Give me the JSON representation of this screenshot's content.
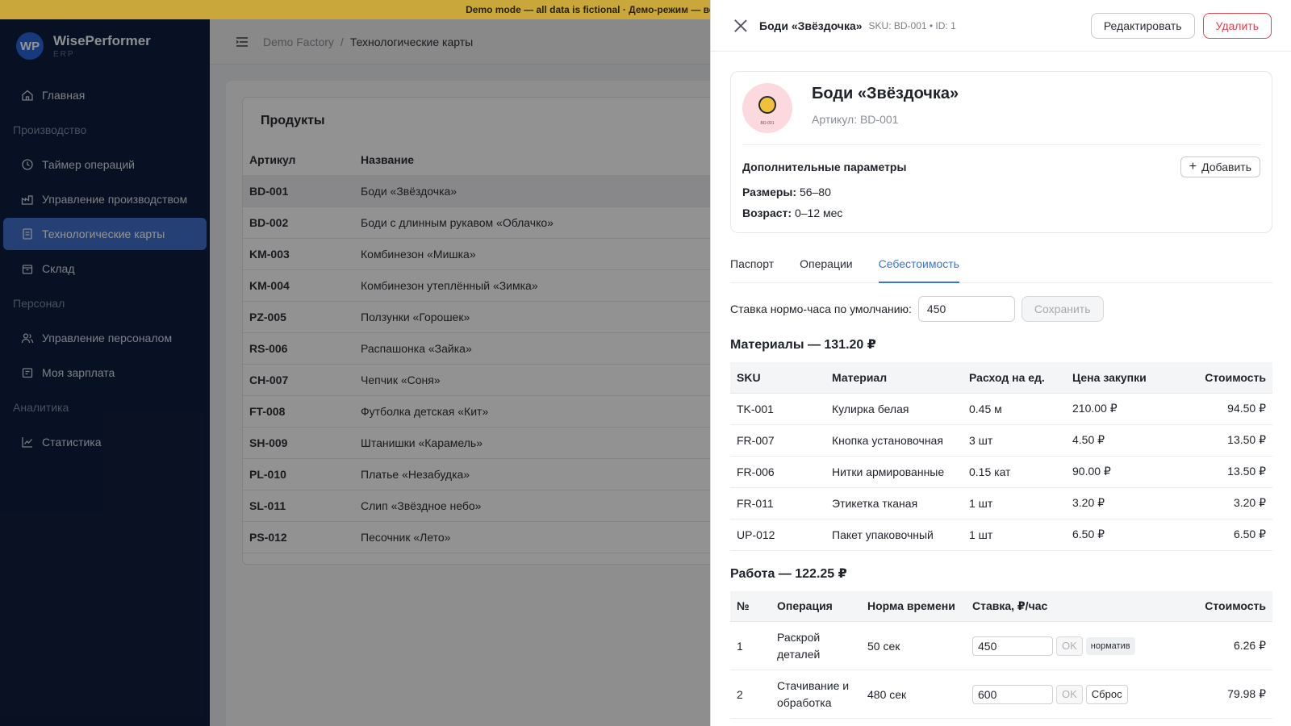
{
  "banner": {
    "text": "Demo mode — all data is fictional · Демо-режим — все данные вымышлены"
  },
  "brand": {
    "logo": "WP",
    "name": "WisePerformer",
    "sub": "ERP"
  },
  "sidebar": {
    "home": "Главная",
    "section_production": "Производство",
    "timer": "Таймер операций",
    "production_mgmt": "Управление производством",
    "tech_cards": "Технологические карты",
    "warehouse": "Склад",
    "section_staff": "Персонал",
    "staff_mgmt": "Управление персоналом",
    "my_salary": "Моя зарплата",
    "section_analytics": "Аналитика",
    "stats": "Статистика"
  },
  "breadcrumb": {
    "root": "Demo Factory",
    "sep": "/",
    "current": "Технологические карты"
  },
  "products": {
    "title": "Продукты",
    "col_sku": "Артикул",
    "col_name": "Название",
    "rows": [
      {
        "sku": "BD-001",
        "name": "Боди «Звёздочка»"
      },
      {
        "sku": "BD-002",
        "name": "Боди с длинным рукавом «Облачко»"
      },
      {
        "sku": "KM-003",
        "name": "Комбинезон «Мишка»"
      },
      {
        "sku": "KM-004",
        "name": "Комбинезон утеплённый «Зимка»"
      },
      {
        "sku": "PZ-005",
        "name": "Ползунки «Горошек»"
      },
      {
        "sku": "RS-006",
        "name": "Распашонка «Зайка»"
      },
      {
        "sku": "CH-007",
        "name": "Чепчик «Соня»"
      },
      {
        "sku": "FT-008",
        "name": "Футболка детская «Кит»"
      },
      {
        "sku": "SH-009",
        "name": "Штанишки «Карамель»"
      },
      {
        "sku": "PL-010",
        "name": "Платье «Незабудка»"
      },
      {
        "sku": "SL-011",
        "name": "Слип «Звёздное небо»"
      },
      {
        "sku": "PS-012",
        "name": "Песочник «Лето»"
      }
    ]
  },
  "drawer": {
    "title": "Боди «Звёздочка»",
    "meta": "SKU: BD-001 • ID: 1",
    "edit": "Редактировать",
    "delete": "Удалить",
    "product_name": "Боди «Звёздочка»",
    "article": "Артикул: BD-001",
    "avatar_tag": "BD-001",
    "params_title": "Дополнительные параметры",
    "add": "Добавить",
    "param1_label": "Размеры:",
    "param1_value": "56–80",
    "param2_label": "Возраст:",
    "param2_value": "0–12 мес",
    "tabs": {
      "passport": "Паспорт",
      "operations": "Операции",
      "cost": "Себестоимость"
    },
    "rate_label": "Ставка нормо-часа по умолчанию:",
    "rate_value": "450",
    "save": "Сохранить",
    "materials_title": "Материалы — 131.20 ₽",
    "mat_cols": {
      "sku": "SKU",
      "material": "Материал",
      "usage": "Расход на ед.",
      "price": "Цена закупки",
      "cost": "Стоимость"
    },
    "materials": [
      {
        "sku": "TK-001",
        "material": "Кулирка белая",
        "usage": "0.45 м",
        "price": "210.00 ₽",
        "cost": "94.50 ₽"
      },
      {
        "sku": "FR-007",
        "material": "Кнопка установочная",
        "usage": "3 шт",
        "price": "4.50 ₽",
        "cost": "13.50 ₽"
      },
      {
        "sku": "FR-006",
        "material": "Нитки армированные",
        "usage": "0.15 кат",
        "price": "90.00 ₽",
        "cost": "13.50 ₽"
      },
      {
        "sku": "FR-011",
        "material": "Этикетка тканая",
        "usage": "1 шт",
        "price": "3.20 ₽",
        "cost": "3.20 ₽"
      },
      {
        "sku": "UP-012",
        "material": "Пакет упаковочный",
        "usage": "1 шт",
        "price": "6.50 ₽",
        "cost": "6.50 ₽"
      }
    ],
    "labor_title": "Работа — 122.25 ₽",
    "lab_cols": {
      "num": "№",
      "operation": "Операция",
      "norm": "Норма времени",
      "rate": "Ставка, ₽/час",
      "cost": "Стоимость"
    },
    "labor": [
      {
        "num": "1",
        "op_line1": "Раскрой",
        "op_line2": "деталей",
        "norm": "50 сек",
        "rate": "450",
        "ok": "OK",
        "badge": "норматив",
        "cost": "6.26 ₽"
      },
      {
        "num": "2",
        "op_line1": "Стачивание и",
        "op_line2": "обработка",
        "norm": "480 сек",
        "rate": "600",
        "ok": "OK",
        "badge": "Сброс",
        "cost": "79.98 ₽"
      }
    ]
  }
}
